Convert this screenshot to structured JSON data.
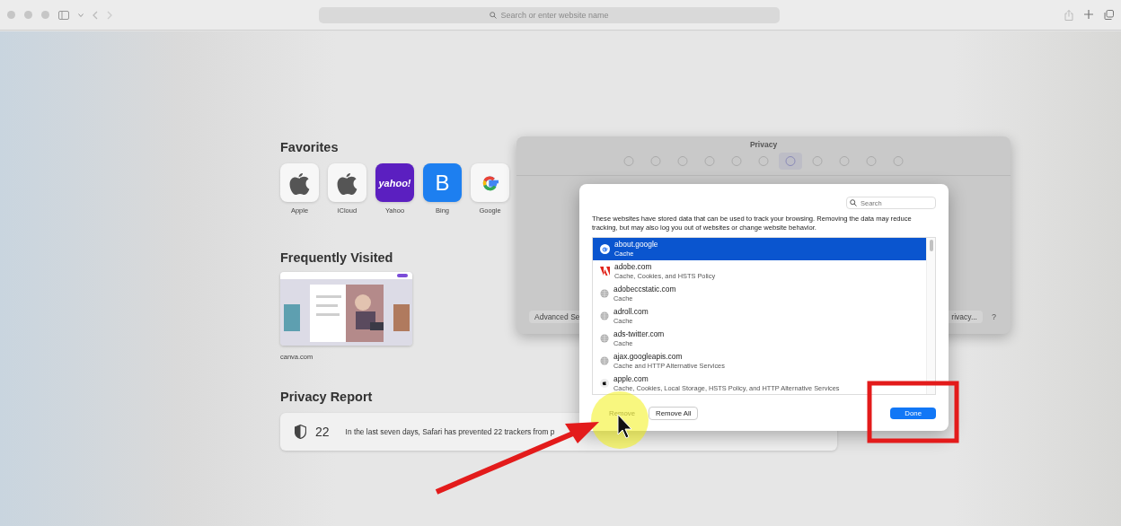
{
  "browser": {
    "address_placeholder": "Search or enter website name"
  },
  "favorites": {
    "title": "Favorites",
    "items": [
      {
        "label": "Apple",
        "kind": "apple"
      },
      {
        "label": "iCloud",
        "kind": "apple"
      },
      {
        "label": "Yahoo",
        "kind": "yahoo",
        "text": "yahoo!"
      },
      {
        "label": "Bing",
        "kind": "bing",
        "text": "B"
      },
      {
        "label": "Google",
        "kind": "google"
      }
    ]
  },
  "frequently_visited": {
    "title": "Frequently Visited",
    "items": [
      {
        "label": "canva.com",
        "kind": "picture"
      }
    ]
  },
  "privacy_report": {
    "title": "Privacy Report",
    "count": "22",
    "text": "In the last seven days, Safari has prevented 22 trackers from p"
  },
  "preferences": {
    "title": "Privacy",
    "tabs": [
      {
        "selected": false
      },
      {
        "selected": false
      },
      {
        "selected": false
      },
      {
        "selected": false
      },
      {
        "selected": false
      },
      {
        "selected": false
      },
      {
        "selected": true
      },
      {
        "selected": false
      },
      {
        "selected": false
      },
      {
        "selected": false
      },
      {
        "selected": false
      }
    ],
    "left_button": "Advanced Se",
    "right_button": "rivacy...",
    "help": "?"
  },
  "website_data": {
    "search_placeholder": "Search",
    "description": "These websites have stored data that can be used to track your browsing. Removing the data may reduce tracking, but may also log you out of websites or change website behavior.",
    "rows": [
      {
        "site": "about.google",
        "data": "Cache",
        "kind": "google",
        "selected": true
      },
      {
        "site": "adobe.com",
        "data": "Cache, Cookies, and HSTS Policy",
        "kind": "adobe",
        "selected": false
      },
      {
        "site": "adobeccstatic.com",
        "data": "Cache",
        "kind": "globe",
        "selected": false
      },
      {
        "site": "adroll.com",
        "data": "Cache",
        "kind": "globe",
        "selected": false
      },
      {
        "site": "ads-twitter.com",
        "data": "Cache",
        "kind": "globe",
        "selected": false
      },
      {
        "site": "ajax.googleapis.com",
        "data": "Cache and HTTP Alternative Services",
        "kind": "globe",
        "selected": false
      },
      {
        "site": "apple.com",
        "data": "Cache, Cookies, Local Storage, HSTS Policy, and HTTP Alternative Services",
        "kind": "apple",
        "selected": false
      }
    ],
    "buttons": [
      {
        "label": "Remove",
        "disabled": true,
        "kind": "normal"
      },
      {
        "label": "Remove All",
        "disabled": false,
        "kind": "normal"
      },
      {
        "label": "Done",
        "disabled": false,
        "kind": "default"
      }
    ]
  }
}
